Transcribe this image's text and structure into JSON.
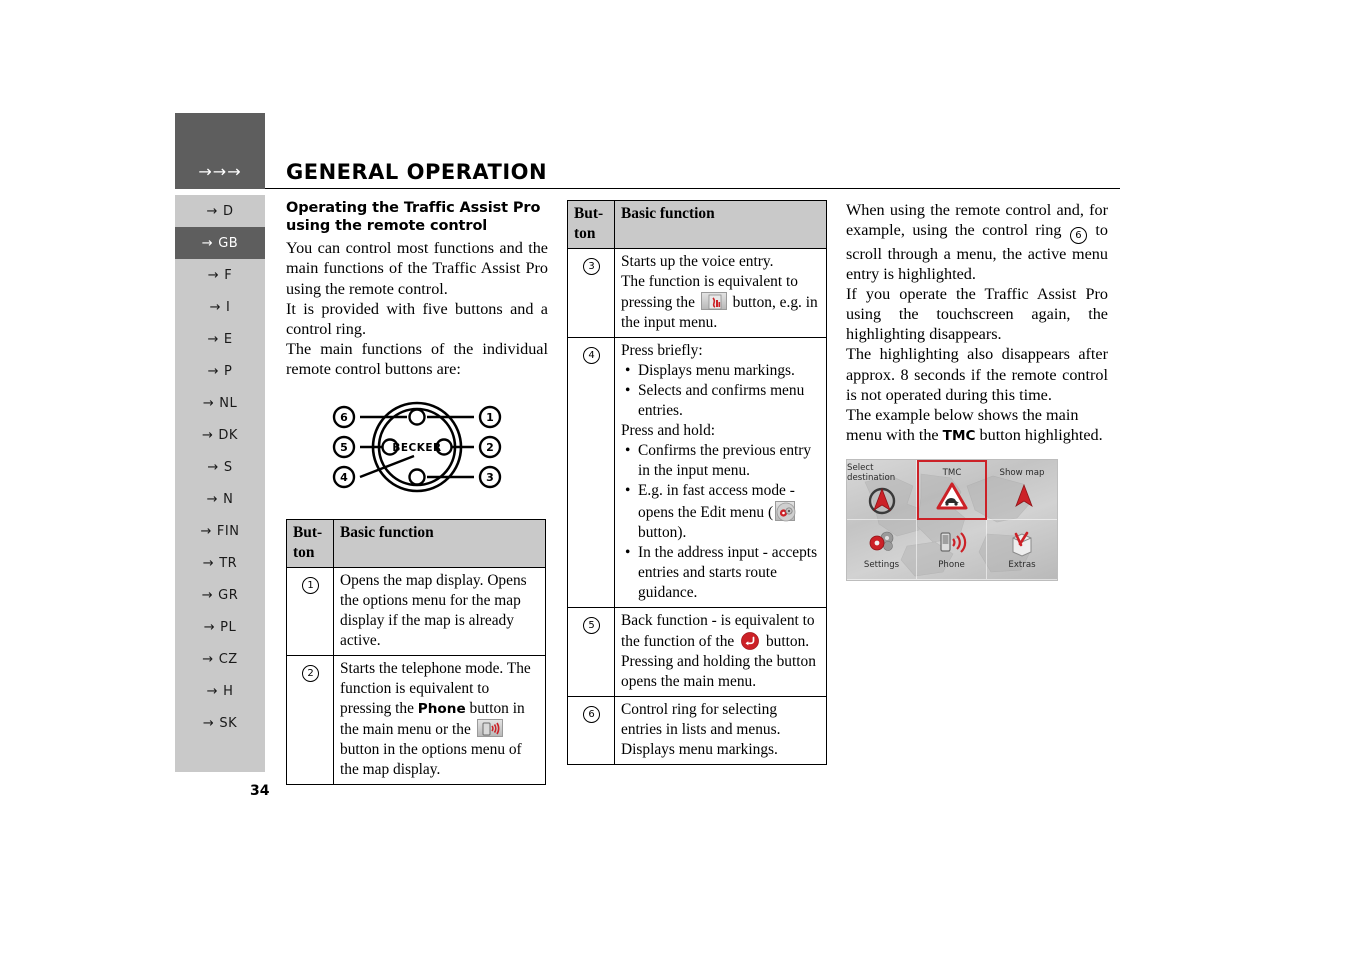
{
  "page": {
    "number": "34",
    "chapter_title": "GENERAL OPERATION",
    "breadcrumb_arrows": "→→→"
  },
  "sidebar": {
    "items": [
      {
        "label": "D",
        "active": false
      },
      {
        "label": "GB",
        "active": true
      },
      {
        "label": "F",
        "active": false
      },
      {
        "label": "I",
        "active": false
      },
      {
        "label": "E",
        "active": false
      },
      {
        "label": "P",
        "active": false
      },
      {
        "label": "NL",
        "active": false
      },
      {
        "label": "DK",
        "active": false
      },
      {
        "label": "S",
        "active": false
      },
      {
        "label": "N",
        "active": false
      },
      {
        "label": "FIN",
        "active": false
      },
      {
        "label": "TR",
        "active": false
      },
      {
        "label": "GR",
        "active": false
      },
      {
        "label": "PL",
        "active": false
      },
      {
        "label": "CZ",
        "active": false
      },
      {
        "label": "H",
        "active": false
      },
      {
        "label": "SK",
        "active": false
      }
    ],
    "arrow_glyph": "→"
  },
  "column1": {
    "section_title_line1": "Operating the Traffic Assist Pro",
    "section_title_line2": "using the remote control",
    "paragraph1": "You can control most functions and the main functions of the Traffic Assist Pro using the remote control.",
    "paragraph2": "It is provided with five buttons and a control ring.",
    "paragraph3": "The main functions of the individual remote control buttons are:",
    "diagram": {
      "brand": "BECKER",
      "callouts": [
        "1",
        "2",
        "3",
        "4",
        "5",
        "6"
      ]
    }
  },
  "table_headers": {
    "button": "But-ton",
    "button_line1": "But-",
    "button_line2": "ton",
    "function": "Basic function"
  },
  "table1": {
    "rows": [
      {
        "button": "1",
        "text": "Opens the map display. Opens the options menu for the map display if the map is already active."
      },
      {
        "button": "2",
        "text_a": "Starts the telephone mode. The function is equivalent to pressing the ",
        "bold_b": "Phone",
        "text_c": " button in the main menu or the ",
        "icon_d": "phone-icon",
        "text_e": " button in the options menu of the map display."
      }
    ]
  },
  "table2": {
    "rows": [
      {
        "button": "3",
        "text_a": "Starts up the voice entry.",
        "text_b": "The function is equivalent to pressing the ",
        "icon_c": "voice-entry-icon",
        "text_d": " button, e.g. in the input menu."
      },
      {
        "button": "4",
        "press_briefly_label": "Press briefly:",
        "bullets_briefly": [
          "Displays menu markings.",
          "Selects and confirms menu entries."
        ],
        "press_hold_label": "Press and hold:",
        "bullets_hold_1": "Confirms the previous entry in the input menu.",
        "bullets_hold_2a": "E.g. in fast access mode - opens the Edit menu (",
        "bullets_hold_2_icon": "edit-menu-icon",
        "bullets_hold_2b": " button).",
        "bullets_hold_3": "In the address input - accepts entries and starts route guidance."
      },
      {
        "button": "5",
        "text_a": "Back function - is equivalent to the function of the ",
        "icon_b": "back-icon",
        "text_c": " button. Pressing and holding the button opens the main menu."
      },
      {
        "button": "6",
        "text_a": "Control ring for selecting entries in lists and menus.",
        "text_b": "Displays menu markings."
      }
    ]
  },
  "column3": {
    "paragraph1a": "When using the remote control and, for example, using the control ring ",
    "paragraph1_ref": "6",
    "paragraph1b": " to scroll through a menu, the active menu entry is highlighted.",
    "paragraph2": "If you operate the Traffic Assist Pro using the touchscreen again, the highlighting disappears.",
    "paragraph3": "The highlighting also disappears after approx. 8 seconds if the remote control is not operated during this time.",
    "paragraph4a": "The example below shows the main menu with the ",
    "paragraph4_bold": "TMC",
    "paragraph4b": " button highlighted."
  },
  "main_menu_screenshot": {
    "cells": [
      {
        "label": "Select destination",
        "icon": "navigation-arrow-icon",
        "selected": false,
        "position": "top"
      },
      {
        "label": "TMC",
        "icon": "traffic-warning-icon",
        "selected": true,
        "position": "top"
      },
      {
        "label": "Show map",
        "icon": "map-arrow-icon",
        "selected": false,
        "position": "top"
      },
      {
        "label": "Settings",
        "icon": "gears-icon",
        "selected": false,
        "position": "bot"
      },
      {
        "label": "Phone",
        "icon": "phone-icon",
        "selected": false,
        "position": "bot"
      },
      {
        "label": "Extras",
        "icon": "extras-box-icon",
        "selected": false,
        "position": "bot"
      }
    ]
  },
  "colors": {
    "sidebar_active": "#5e5e5e",
    "sidebar_bg": "#c9c9c9",
    "accent_red": "#cc2127",
    "table_header_bg": "#c9c9c9"
  }
}
